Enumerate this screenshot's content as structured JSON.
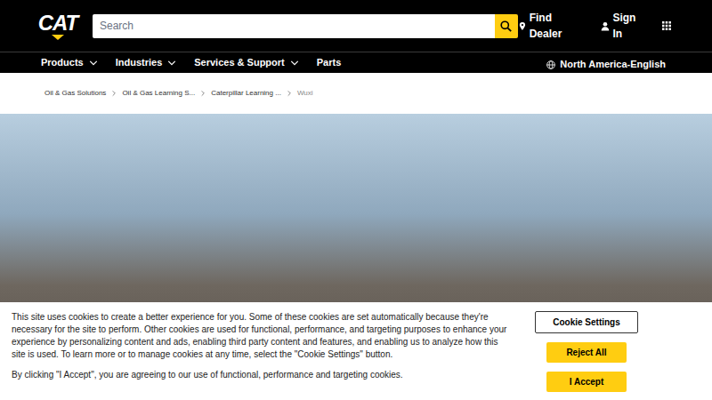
{
  "header": {
    "logo": "CAT",
    "search": {
      "placeholder": "Search"
    },
    "links": [
      {
        "label": "Find Dealer"
      },
      {
        "label": "Sign In"
      }
    ]
  },
  "nav": {
    "items": [
      {
        "label": "Products",
        "kind": "menu"
      },
      {
        "label": "Industries",
        "kind": "menu"
      },
      {
        "label": "Services & Support",
        "kind": "menu"
      },
      {
        "label": "Parts",
        "kind": "link"
      }
    ],
    "locale": "North America-English"
  },
  "breadcrumbs": [
    {
      "label": "Oil & Gas Solutions",
      "current": false
    },
    {
      "label": "Oil & Gas Learning S...",
      "current": false
    },
    {
      "label": "Caterpillar Learning ...",
      "current": false
    },
    {
      "label": "Wuxi",
      "current": true
    }
  ],
  "cookie_banner": {
    "text": "This site uses cookies to create a better experience for you. Some of these cookies are set automatically because they're necessary for the site to perform. Other cookies are used for functional, performance, and targeting purposes to enhance your experience by personalizing content and ads, enabling third party content and features, and enabling us to analyze how this site is used. To learn more or to manage cookies at any time, select the \"Cookie Settings\" button.",
    "consent": "By clicking \"I Accept\", you are agreeing to our use of functional, performance and targeting cookies.",
    "buttons": [
      {
        "label": "Cookie Settings",
        "kind": "outline"
      },
      {
        "label": "Reject All",
        "kind": "primary"
      },
      {
        "label": "I Accept",
        "kind": "primary"
      }
    ]
  }
}
